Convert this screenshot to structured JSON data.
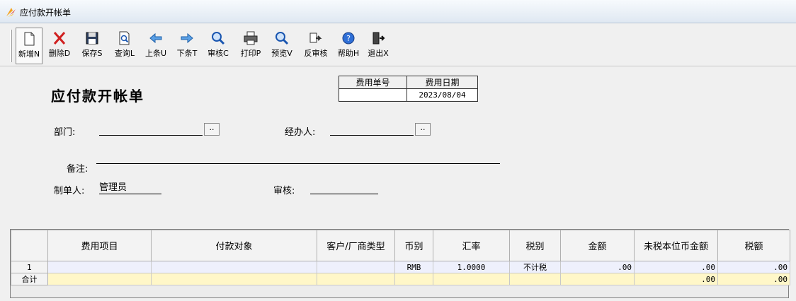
{
  "window": {
    "title": "应付款开帐单"
  },
  "toolbar": {
    "buttons": [
      {
        "label": "新增N",
        "icon": "new-document-icon"
      },
      {
        "label": "删除D",
        "icon": "delete-x-icon"
      },
      {
        "label": "保存S",
        "icon": "save-disk-icon"
      },
      {
        "label": "查询L",
        "icon": "search-document-icon"
      },
      {
        "label": "上条U",
        "icon": "arrow-left-icon"
      },
      {
        "label": "下条T",
        "icon": "arrow-right-icon"
      },
      {
        "label": "审核C",
        "icon": "magnifier-icon"
      },
      {
        "label": "打印P",
        "icon": "printer-icon"
      },
      {
        "label": "预览V",
        "icon": "preview-magnifier-icon"
      },
      {
        "label": "反审核",
        "icon": "unapprove-icon"
      },
      {
        "label": "帮助H",
        "icon": "help-icon"
      },
      {
        "label": "退出X",
        "icon": "exit-door-icon"
      }
    ]
  },
  "form": {
    "doc_title": "应付款开帐单",
    "fee_no_label": "费用单号",
    "fee_no_value": "",
    "fee_date_label": "费用日期",
    "fee_date_value": "2023/08/04",
    "dept_label": "部门:",
    "dept_value": "",
    "handler_label": "经办人:",
    "handler_value": "",
    "lookup_btn": "..",
    "remark_label": "备注:",
    "remark_value": "",
    "maker_label": "制单人:",
    "maker_value": "管理员",
    "audit_label": "审核:",
    "audit_value": ""
  },
  "grid": {
    "columns": [
      "费用项目",
      "付款对象",
      "客户/厂商类型",
      "币别",
      "汇率",
      "税别",
      "金额",
      "未税本位币金额",
      "税额"
    ],
    "rows": [
      {
        "num": "1",
        "item": "",
        "payee": "",
        "type": "",
        "currency": "RMB",
        "rate": "1.0000",
        "tax": "不计税",
        "amount": ".00",
        "untaxed": ".00",
        "taxamt": ".00"
      }
    ],
    "total": {
      "label": "合计",
      "untaxed": ".00",
      "taxamt": ".00"
    }
  },
  "colors": {
    "row_bg": "#eef0fc",
    "total_bg": "#fff7c8"
  }
}
